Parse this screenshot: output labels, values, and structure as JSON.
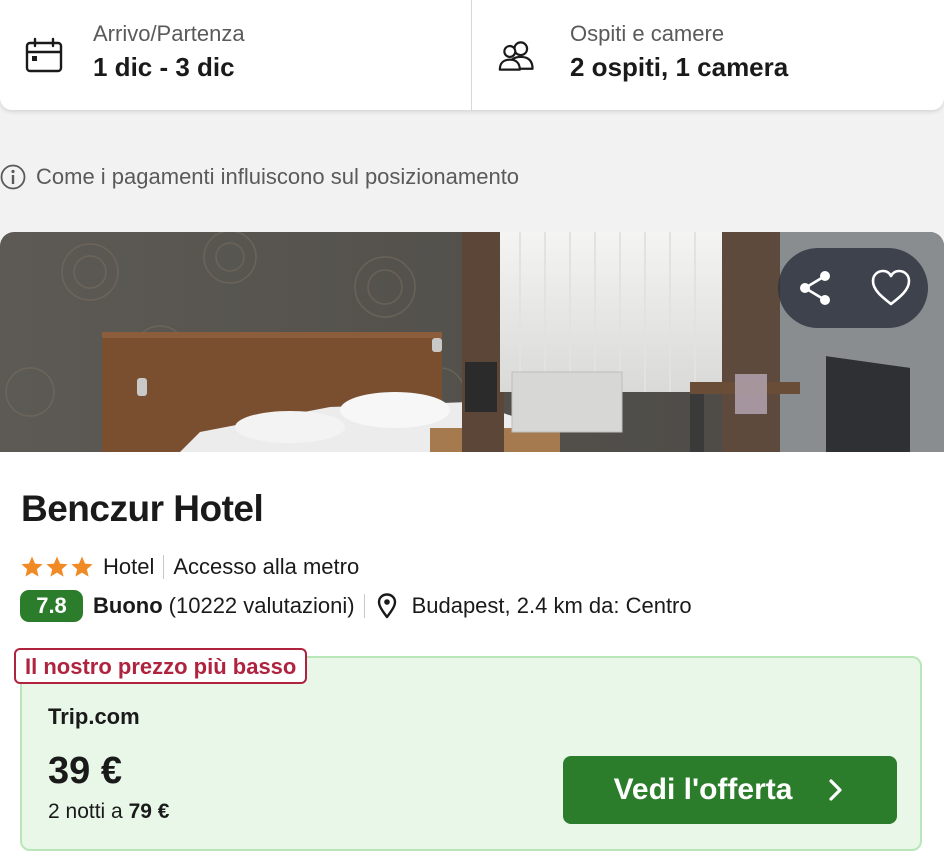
{
  "search": {
    "dates_label": "Arrivo/Partenza",
    "dates_value": "1 dic - 3 dic",
    "guests_label": "Ospiti e camere",
    "guests_value": "2 ospiti, 1 camera"
  },
  "disclaimer": "Come i pagamenti influiscono sul posizionamento",
  "hotel": {
    "name": "Benczur Hotel",
    "stars": 3,
    "type": "Hotel",
    "feature": "Accesso alla metro",
    "score": "7.8",
    "rating_word": "Buono",
    "reviews": "(10222 valutazioni)",
    "location": "Budapest, 2.4 km da: Centro"
  },
  "offer": {
    "badge": "Il nostro prezzo più basso",
    "provider": "Trip.com",
    "price": "39 €",
    "nights_prefix": "2 notti a ",
    "nights_total": "79 €",
    "cta_label": "Vedi l'offerta"
  },
  "icons": {
    "calendar": "calendar-icon",
    "guests": "people-icon",
    "info": "info-icon",
    "share": "share-icon",
    "favorite": "heart-icon",
    "star": "star-icon",
    "location": "location-pin-icon",
    "chevron": "chevron-right-icon"
  },
  "colors": {
    "score_bg": "#2b7d2b",
    "cta_bg": "#2b7d2b",
    "badge": "#b0233f",
    "offer_bg": "#e8f7e8",
    "star": "#f08a24"
  }
}
